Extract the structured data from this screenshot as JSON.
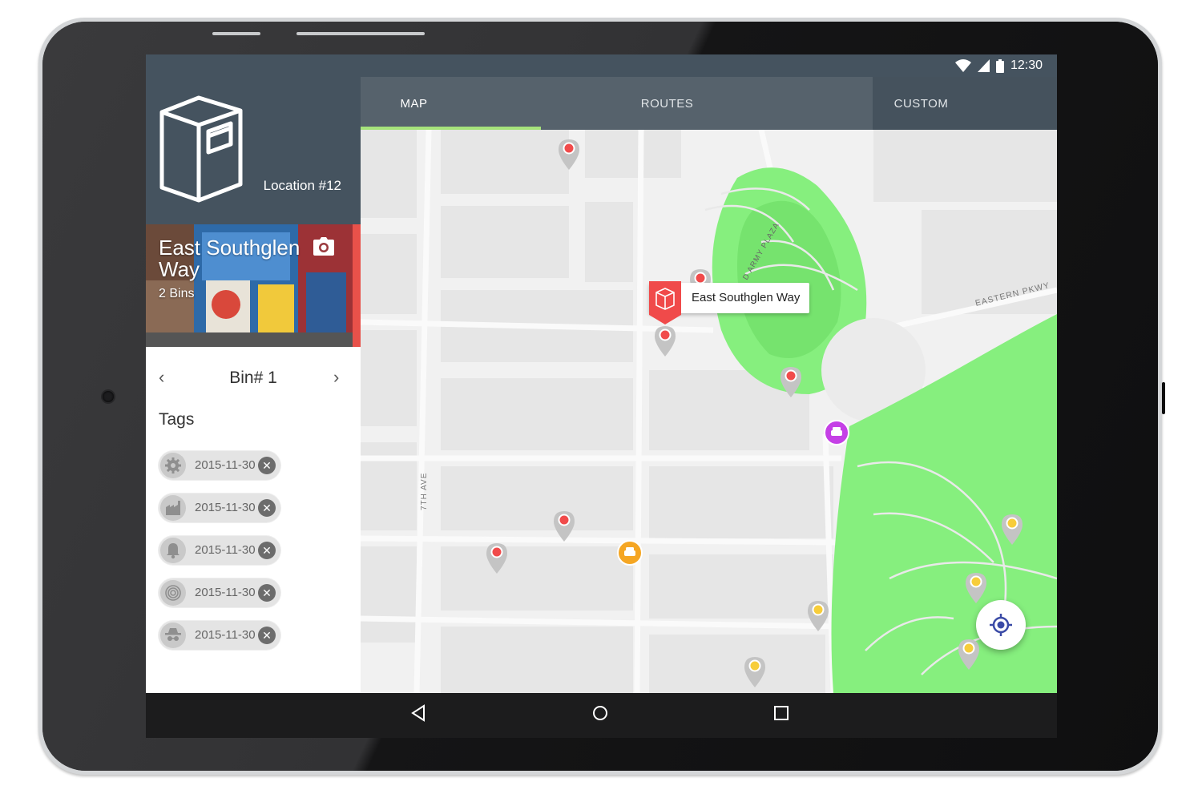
{
  "status_bar": {
    "time": "12:30",
    "icons": [
      "wifi-icon",
      "cell-signal-icon",
      "battery-icon"
    ]
  },
  "location": {
    "label": "Location #12",
    "title": "East Southglen Way",
    "subtitle": "2 Bins",
    "icons": [
      "bin-logo-icon",
      "camera-icon"
    ]
  },
  "bin": {
    "title": "Bin# 1",
    "prev_icon": "chevron-left-icon",
    "next_icon": "chevron-right-icon"
  },
  "tags": {
    "title": "Tags",
    "items": [
      {
        "icon": "gear-icon",
        "date": "2015-11-30"
      },
      {
        "icon": "factory-icon",
        "date": "2015-11-30"
      },
      {
        "icon": "bell-icon",
        "date": "2015-11-30"
      },
      {
        "icon": "target-icon",
        "date": "2015-11-30"
      },
      {
        "icon": "spy-icon",
        "date": "2015-11-30"
      }
    ],
    "remove_icon": "close-icon"
  },
  "tabs": [
    {
      "label": "MAP",
      "active": true
    },
    {
      "label": "ROUTES",
      "active": false
    },
    {
      "label": "CUSTOM",
      "active": false
    }
  ],
  "map": {
    "callout": "East Southglen Way",
    "street_labels": [
      "7TH AVE",
      "EASTERN PKWY",
      "D ARMY PLAZA"
    ],
    "colors": {
      "park": "#86ef7e",
      "pin_red": "#f14b4b",
      "pin_yellow": "#f7cd3a",
      "vehicle_orange": "#f5a623",
      "vehicle_purple": "#c540e6",
      "accent_green": "#a6e37b",
      "header": "#45535f",
      "callout_red": "#f04a4a"
    }
  },
  "nav_bar": {
    "icons": [
      "back-icon",
      "home-icon",
      "recents-icon"
    ]
  },
  "fab_icon": "gps-locate-icon"
}
